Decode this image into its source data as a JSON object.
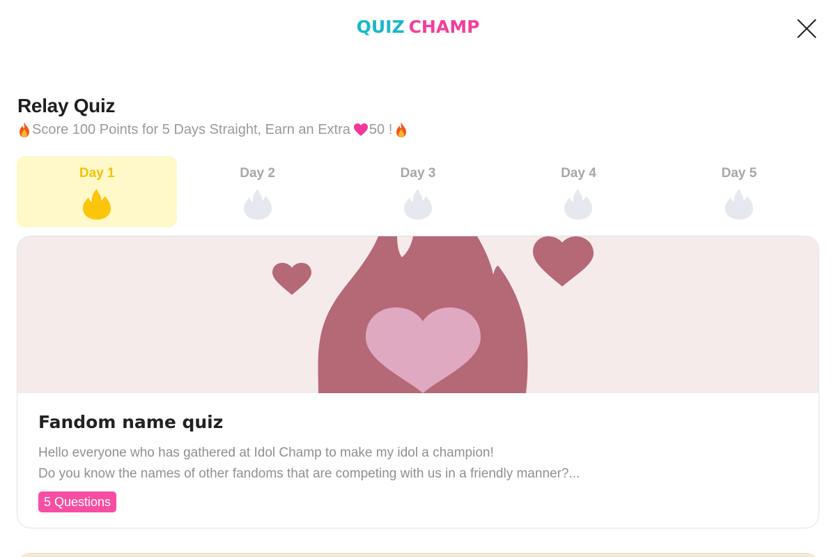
{
  "header": {
    "logo_part1": "QUIZ",
    "logo_part2": "CHAMP",
    "logo_colors": {
      "quiz": "#19b8c9",
      "champ": "#f23f9b"
    },
    "close_icon": "close-icon"
  },
  "relay": {
    "title": "Relay Quiz",
    "subtitle_text": "Score 100 Points for 5 Days Straight, Earn an Extra ",
    "subtitle_amount": "50 !",
    "subtitle_icons": [
      "fire-icon",
      "heart-icon",
      "fire-icon"
    ]
  },
  "days": [
    {
      "label": "Day 1",
      "active": true,
      "icon": "flame-icon"
    },
    {
      "label": "Day 2",
      "active": false,
      "icon": "flame-icon"
    },
    {
      "label": "Day 3",
      "active": false,
      "icon": "flame-icon"
    },
    {
      "label": "Day 4",
      "active": false,
      "icon": "flame-icon"
    },
    {
      "label": "Day 5",
      "active": false,
      "icon": "flame-icon"
    }
  ],
  "colors": {
    "active_day_bg": "#fff8c8",
    "active_day_text": "#f0c20b",
    "active_flame": "#fcc40b",
    "inactive_flame": "#e6e8f0",
    "banner_bg": "#f5ebea",
    "badge_bg": "#f74ea3"
  },
  "quiz_card": {
    "title": "Fandom name quiz",
    "description_line1": "Hello everyone who has gathered at Idol Champ to make my idol a champion!",
    "description_line2": "Do you know the names of other fandoms that are competing with us in a friendly manner?...",
    "badge": "5 Questions",
    "banner_icon": "flame-heart-illustration"
  }
}
